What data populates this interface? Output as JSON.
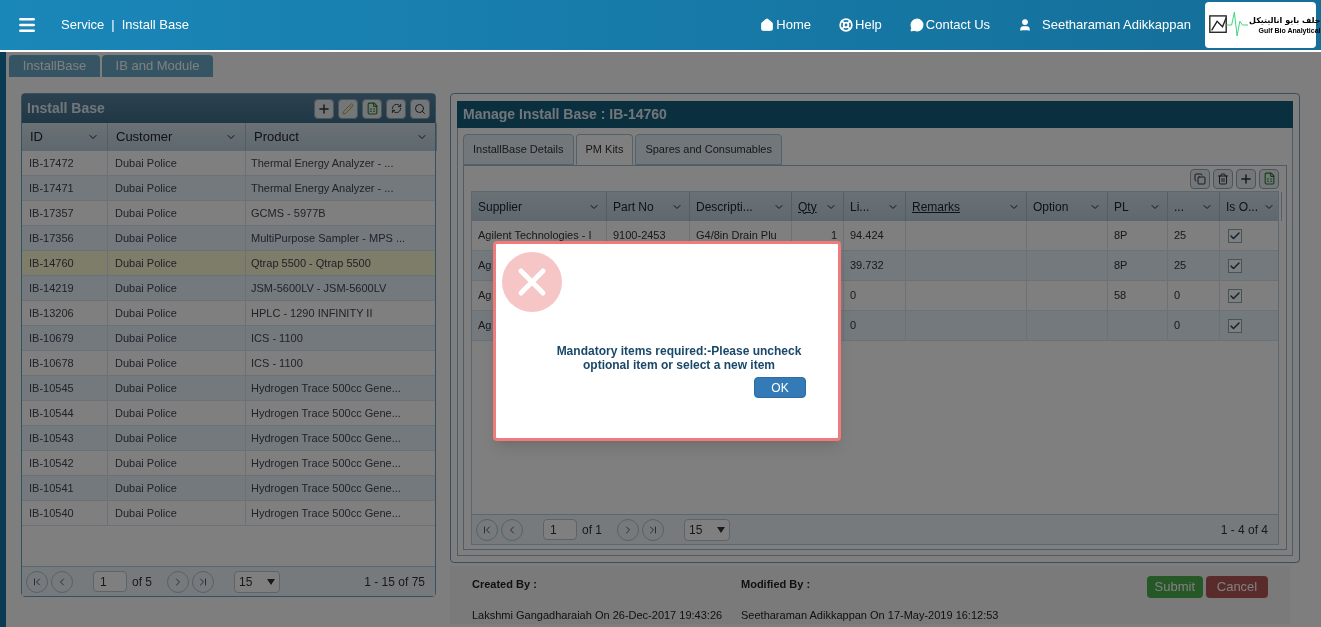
{
  "header": {
    "section": "Service",
    "separator": "|",
    "page": "Install Base",
    "nav": [
      {
        "kind": "home",
        "label": "Home"
      },
      {
        "kind": "help",
        "label": "Help"
      },
      {
        "kind": "contact",
        "label": "Contact Us"
      },
      {
        "kind": "user",
        "label": "Seetharaman Adikkappan"
      }
    ],
    "logo": {
      "arabic": "جلف بايو اناليتيكل",
      "name": "Gulf Bio Analytical"
    }
  },
  "module_tabs": [
    "InstallBase",
    "IB and Module"
  ],
  "install_base": {
    "title": "Install Base",
    "columns": [
      "ID",
      "Customer",
      "Product"
    ],
    "rows": [
      {
        "id": "IB-17472",
        "customer": "Dubai Police",
        "product": "Thermal Energy Analyzer - ...",
        "selected": false
      },
      {
        "id": "IB-17471",
        "customer": "Dubai Police",
        "product": "Thermal Energy Analyzer - ...",
        "selected": false
      },
      {
        "id": "IB-17357",
        "customer": "Dubai Police",
        "product": "GCMS - 5977B",
        "selected": false
      },
      {
        "id": "IB-17356",
        "customer": "Dubai Police",
        "product": "MultiPurpose Sampler - MPS ...",
        "selected": false
      },
      {
        "id": "IB-14760",
        "customer": "Dubai Police",
        "product": "Qtrap 5500 - Qtrap 5500",
        "selected": true
      },
      {
        "id": "IB-14219",
        "customer": "Dubai Police",
        "product": "JSM-5600LV - JSM-5600LV",
        "selected": false
      },
      {
        "id": "IB-13206",
        "customer": "Dubai Police",
        "product": "HPLC - 1290 INFINITY II",
        "selected": false
      },
      {
        "id": "IB-10679",
        "customer": "Dubai Police",
        "product": "ICS - 1100",
        "selected": false
      },
      {
        "id": "IB-10678",
        "customer": "Dubai Police",
        "product": "ICS - 1100",
        "selected": false
      },
      {
        "id": "IB-10545",
        "customer": "Dubai Police",
        "product": "Hydrogen Trace 500cc Gene...",
        "selected": false
      },
      {
        "id": "IB-10544",
        "customer": "Dubai Police",
        "product": "Hydrogen Trace 500cc Gene...",
        "selected": false
      },
      {
        "id": "IB-10543",
        "customer": "Dubai Police",
        "product": "Hydrogen Trace 500cc Gene...",
        "selected": false
      },
      {
        "id": "IB-10542",
        "customer": "Dubai Police",
        "product": "Hydrogen Trace 500cc Gene...",
        "selected": false
      },
      {
        "id": "IB-10541",
        "customer": "Dubai Police",
        "product": "Hydrogen Trace 500cc Gene...",
        "selected": false
      },
      {
        "id": "IB-10540",
        "customer": "Dubai Police",
        "product": "Hydrogen Trace 500cc Gene...",
        "selected": false
      }
    ],
    "pager": {
      "page": "1",
      "of": "of 5",
      "page_size": "15",
      "summary": "1 - 15 of 75"
    }
  },
  "manage": {
    "title": "Manage Install Base : IB-14760",
    "tabs": [
      {
        "label": "InstallBase Details",
        "selected": false
      },
      {
        "label": "PM Kits",
        "selected": true
      },
      {
        "label": "Spares and Consumables",
        "selected": false
      }
    ],
    "columns": [
      {
        "label": "Supplier",
        "underlined": false
      },
      {
        "label": "Part No",
        "underlined": false
      },
      {
        "label": "Descripti...",
        "underlined": false
      },
      {
        "label": "Qty",
        "underlined": true
      },
      {
        "label": "Li...",
        "underlined": false
      },
      {
        "label": "Remarks",
        "underlined": true
      },
      {
        "label": "Option",
        "underlined": false
      },
      {
        "label": "PL",
        "underlined": false
      },
      {
        "label": "...",
        "underlined": false
      },
      {
        "label": "Is O...",
        "underlined": false
      }
    ],
    "rows": [
      {
        "cells": [
          "Agilent Technologies - I",
          "9100-2453",
          "G4/8in Drain Plu",
          "1",
          "94.424",
          "",
          "",
          "8P",
          "25"
        ],
        "checked": true
      },
      {
        "cells": [
          "Ag",
          "",
          "",
          "",
          "39.732",
          "",
          "",
          "8P",
          "25"
        ],
        "checked": true
      },
      {
        "cells": [
          "Ag",
          "",
          "",
          "",
          "0",
          "",
          "",
          "58",
          "0"
        ],
        "checked": true
      },
      {
        "cells": [
          "Ag",
          "",
          "",
          "",
          "0",
          "",
          "",
          "",
          "0"
        ],
        "checked": true
      }
    ],
    "pager": {
      "page": "1",
      "of": "of 1",
      "page_size": "15",
      "summary": "1 - 4 of 4"
    },
    "created_label": "Created By :",
    "created_value": "Lakshmi Gangadharaiah On 26-Dec-2017 19:43:26",
    "modified_label": "Modified By :",
    "modified_value": "Seetharaman Adikkappan On 17-May-2019 16:12:53",
    "buttons": [
      {
        "kind": "submit",
        "label": "Submit"
      },
      {
        "kind": "cancel",
        "label": "Cancel"
      }
    ]
  },
  "dialog": {
    "message": "Mandatory items required:-Please uncheck optional item or select a new item",
    "button": "OK"
  }
}
